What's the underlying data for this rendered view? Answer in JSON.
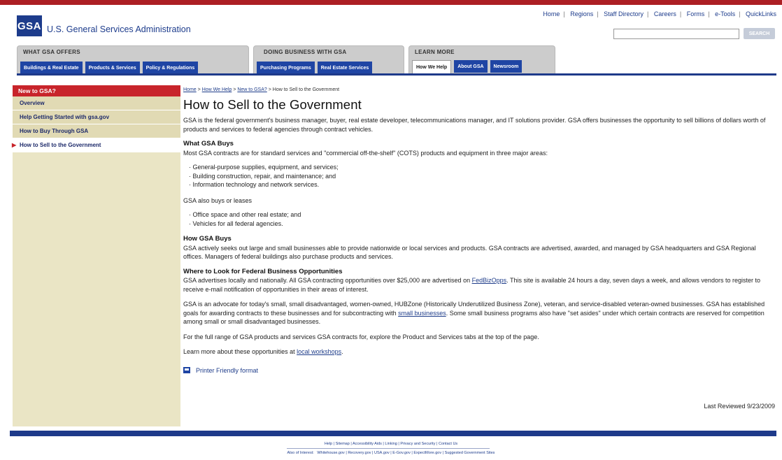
{
  "header": {
    "logo_mark": "GSA",
    "logo_text": "U.S. General Services Administration",
    "utility_links": [
      "Home",
      "Regions",
      "Staff Directory",
      "Careers",
      "Forms",
      "e-Tools",
      "QuickLinks"
    ],
    "search_placeholder": "",
    "search_button": "SEARCH"
  },
  "nav": {
    "groups": [
      {
        "title": "WHAT GSA OFFERS",
        "tabs": [
          "Buildings & Real Estate",
          "Products & Services",
          "Policy & Regulations"
        ]
      },
      {
        "title": "DOING BUSINESS WITH GSA",
        "tabs": [
          "Purchasing Programs",
          "Real Estate Services"
        ]
      },
      {
        "title": "LEARN MORE",
        "tabs": [
          "How We Help",
          "About GSA",
          "Newsroom"
        ],
        "active": "How We Help"
      }
    ]
  },
  "sidebar": {
    "heading": "New to GSA?",
    "items": [
      "Overview",
      "Help Getting Started with gsa.gov",
      "How to Buy Through GSA",
      "How to Sell to the Government"
    ],
    "current": "How to Sell to the Government"
  },
  "breadcrumb": {
    "links": [
      "Home",
      "How We Help",
      "New to GSA?"
    ],
    "current": "How to Sell to the Government",
    "separator": ">"
  },
  "page": {
    "title": "How to Sell to the Government",
    "intro": "GSA is the federal government's business manager, buyer, real estate developer, telecommunications manager, and IT solutions provider. GSA offers businesses the opportunity to sell billions of dollars worth of products and services to federal agencies through contract vehicles.",
    "what_heading": "What GSA Buys",
    "what_text": "Most GSA contracts are for standard services and \"commercial off-the-shelf\" (COTS) products and equipment in three major areas:",
    "what_list": [
      "General-purpose supplies, equipment, and services;",
      "Building construction, repair, and maintenance; and",
      "Information technology and network services."
    ],
    "also_text": "GSA also buys or leases",
    "also_list": [
      "Office space and other real estate; and",
      "Vehicles for all federal agencies."
    ],
    "how_heading": "How GSA Buys",
    "how_text": "GSA actively seeks out large and small businesses able to provide nationwide or local services and products. GSA contracts are advertised, awarded, and managed by GSA headquarters and GSA Regional offices. Managers of federal buildings also purchase products and services.",
    "where_heading": "Where to Look for Federal Business Opportunities",
    "where_text_a": "GSA advertises locally and nationally. All GSA contracting opportunities over $25,000 are advertised on ",
    "where_link": "FedBizOpps",
    "where_text_b": ". This site is available 24 hours a day, seven days a week, and allows vendors to register to receive e-mail notification of opportunities in their areas of interest.",
    "advocate_text_a": "GSA is an advocate for today's small, small disadvantaged, women-owned, HUBZone (Historically Underutilized Business Zone), veteran, and service-disabled veteran-owned businesses. GSA has established goals for awarding contracts to these businesses and for subcontracting with ",
    "advocate_link": "small businesses",
    "advocate_text_b": ". Some small business programs also have \"set asides\" under which certain contracts are reserved for competition among small or small disadvantaged businesses.",
    "range_text": "For the full range of GSA products and services GSA contracts for, explore the Product and Services tabs at the top of the page.",
    "learn_text": "Learn more about these opportunities at ",
    "learn_link": "local workshops",
    "learn_end": ".",
    "printer": "Printer Friendly format",
    "last_reviewed": "Last Reviewed 9/23/2009"
  },
  "footer": {
    "links": [
      "Help",
      "Sitemap",
      "Accessibility Aids",
      "Linking",
      "Privacy and Security",
      "Contact Us"
    ],
    "also_label": "Also of Interest:",
    "also_links": [
      "Whitehouse.gov",
      "Recovery.gov",
      "USA.gov",
      "E-Gov.gov",
      "ExpectMore.gov",
      "Suggested Government Sites"
    ]
  },
  "colors": {
    "brand_blue": "#1d3c8c",
    "accent_red": "#c8242b",
    "sidebar_bg": "#eae5c5"
  }
}
